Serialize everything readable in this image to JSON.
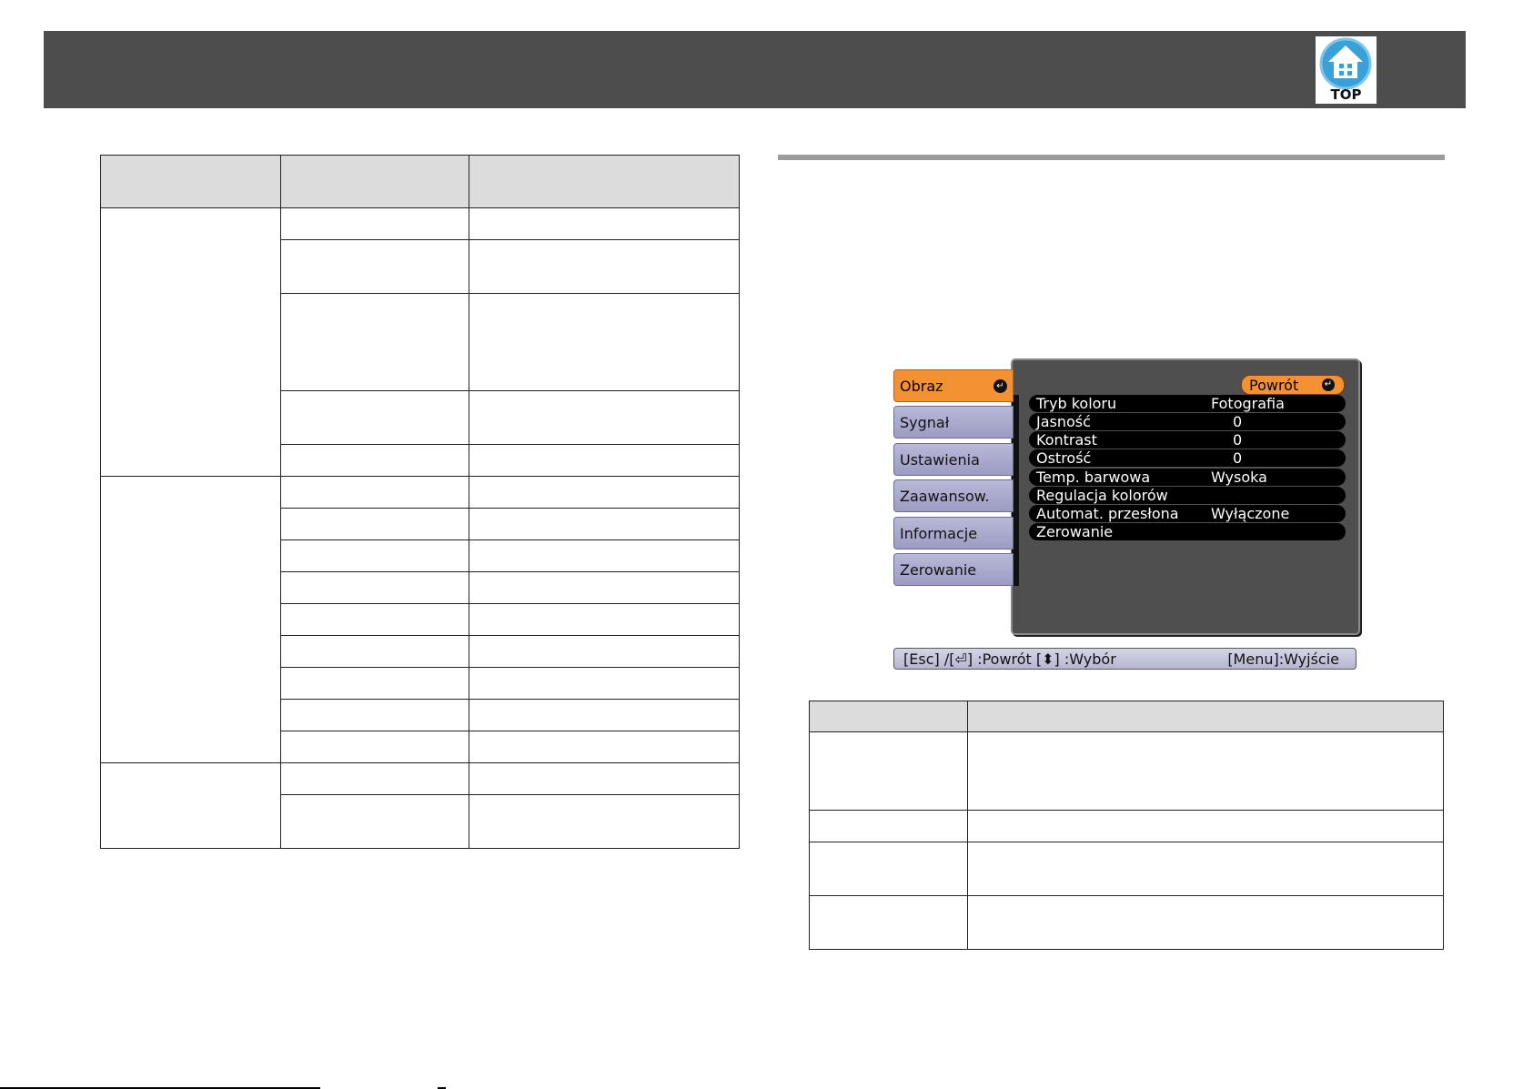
{
  "header": {
    "top_logo_label": "TOP"
  },
  "left_table": {
    "rows": [
      {
        "label": "",
        "cells": [
          ""
        ]
      },
      {
        "label": "",
        "cells": [
          "",
          "",
          "",
          "",
          "",
          "",
          "",
          "",
          "",
          "",
          "",
          "",
          "",
          "",
          ""
        ]
      }
    ]
  },
  "osd": {
    "tabs": [
      "Obraz",
      "Sygnał",
      "Ustawienia",
      "Zaawansow.",
      "Informacje",
      "Zerowanie"
    ],
    "back_label": "Powrót",
    "items": [
      {
        "label": "Tryb koloru",
        "value": "Fotografia"
      },
      {
        "label": "Jasność",
        "value": "0"
      },
      {
        "label": "Kontrast",
        "value": "0"
      },
      {
        "label": "Ostrość",
        "value": "0"
      },
      {
        "label": "Temp. barwowa",
        "value": "Wysoka"
      },
      {
        "label": "Regulacja kolorów",
        "value": ""
      },
      {
        "label": "Automat. przesłona",
        "value": "Wyłączone"
      },
      {
        "label": "Zerowanie",
        "value": ""
      }
    ],
    "footer_left": "[Esc] /[⏎] :Powrót [⬍] :Wybór",
    "footer_right": "[Menu]:Wyjście"
  }
}
